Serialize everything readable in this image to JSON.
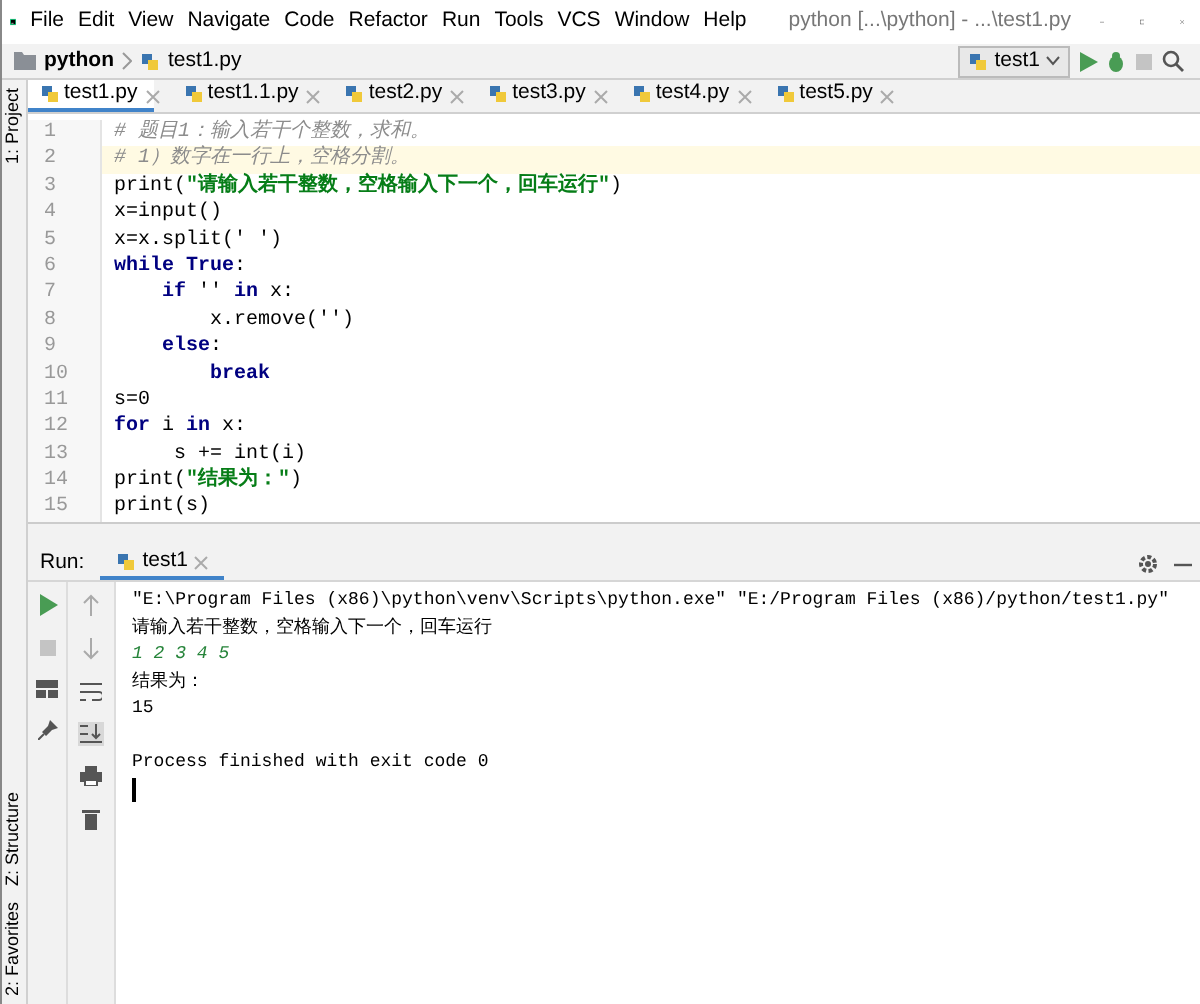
{
  "window": {
    "title": "python [...\\python] - ...\\test1.py"
  },
  "menu": [
    "File",
    "Edit",
    "View",
    "Navigate",
    "Code",
    "Refactor",
    "Run",
    "Tools",
    "VCS",
    "Window",
    "Help"
  ],
  "breadcrumb": [
    {
      "label": "python",
      "kind": "folder"
    },
    {
      "label": "test1.py",
      "kind": "file"
    }
  ],
  "run_config": {
    "label": "test1"
  },
  "side_tabs_top": [
    {
      "label": "1: Project"
    }
  ],
  "side_tabs_bottom": [
    {
      "label": "Z: Structure"
    },
    {
      "label": "2: Favorites"
    }
  ],
  "editor_tabs": [
    {
      "label": "test1.py",
      "selected": true
    },
    {
      "label": "test1.1.py",
      "selected": false
    },
    {
      "label": "test2.py",
      "selected": false
    },
    {
      "label": "test3.py",
      "selected": false
    },
    {
      "label": "test4.py",
      "selected": false
    },
    {
      "label": "test5.py",
      "selected": false
    }
  ],
  "code_lines": [
    {
      "number": "1",
      "current": false,
      "tokens": [
        {
          "kind": "comment",
          "text": "# 题目1：输入若干个整数，求和。"
        }
      ]
    },
    {
      "number": "2",
      "current": true,
      "tokens": [
        {
          "kind": "comment",
          "text": "# 1）数字在一行上，空格分割。"
        }
      ]
    },
    {
      "number": "3",
      "current": false,
      "tokens": [
        {
          "kind": "plain",
          "text": "print("
        },
        {
          "kind": "string",
          "text": "\"请输入若干整数，空格输入下一个，回车运行\""
        },
        {
          "kind": "plain",
          "text": ")"
        }
      ]
    },
    {
      "number": "4",
      "current": false,
      "tokens": [
        {
          "kind": "plain",
          "text": "x=input()"
        }
      ]
    },
    {
      "number": "5",
      "current": false,
      "tokens": [
        {
          "kind": "plain",
          "text": "x=x.split(' ')"
        }
      ]
    },
    {
      "number": "6",
      "current": false,
      "tokens": [
        {
          "kind": "keyword",
          "text": "while True"
        },
        {
          "kind": "plain",
          "text": ":"
        }
      ]
    },
    {
      "number": "7",
      "current": false,
      "tokens": [
        {
          "kind": "keyword",
          "text": "    if"
        },
        {
          "kind": "plain",
          "text": " '' "
        },
        {
          "kind": "keyword",
          "text": "in"
        },
        {
          "kind": "plain",
          "text": " x:"
        }
      ]
    },
    {
      "number": "8",
      "current": false,
      "tokens": [
        {
          "kind": "plain",
          "text": "        x.remove('')"
        }
      ]
    },
    {
      "number": "9",
      "current": false,
      "tokens": [
        {
          "kind": "keyword",
          "text": "    else"
        },
        {
          "kind": "plain",
          "text": ":"
        }
      ]
    },
    {
      "number": "10",
      "current": false,
      "tokens": [
        {
          "kind": "keyword",
          "text": "        break"
        }
      ]
    },
    {
      "number": "11",
      "current": false,
      "tokens": [
        {
          "kind": "plain",
          "text": "s=0"
        }
      ]
    },
    {
      "number": "12",
      "current": false,
      "tokens": [
        {
          "kind": "keyword",
          "text": "for"
        },
        {
          "kind": "plain",
          "text": " i "
        },
        {
          "kind": "keyword",
          "text": "in"
        },
        {
          "kind": "plain",
          "text": " x:"
        }
      ]
    },
    {
      "number": "13",
      "current": false,
      "tokens": [
        {
          "kind": "plain",
          "text": "     s += int(i)"
        }
      ]
    },
    {
      "number": "14",
      "current": false,
      "tokens": [
        {
          "kind": "plain",
          "text": "print("
        },
        {
          "kind": "string",
          "text": "\"结果为：\""
        },
        {
          "kind": "plain",
          "text": ")"
        }
      ]
    },
    {
      "number": "15",
      "current": false,
      "tokens": [
        {
          "kind": "plain",
          "text": "print(s)"
        }
      ]
    }
  ],
  "run_panel": {
    "label": "Run:",
    "tab": "test1",
    "lines": [
      {
        "kind": "command",
        "text": "\"E:\\Program Files (x86)\\python\\venv\\Scripts\\python.exe\" \"E:/Program Files (x86)/python/test1.py\""
      },
      {
        "kind": "output",
        "text": "请输入若干整数，空格输入下一个，回车运行"
      },
      {
        "kind": "input",
        "text": "1 2 3 4 5"
      },
      {
        "kind": "output",
        "text": "结果为："
      },
      {
        "kind": "output",
        "text": "15"
      },
      {
        "kind": "blank"
      },
      {
        "kind": "output",
        "text": "Process finished with exit code 0"
      },
      {
        "kind": "cursor"
      }
    ]
  }
}
